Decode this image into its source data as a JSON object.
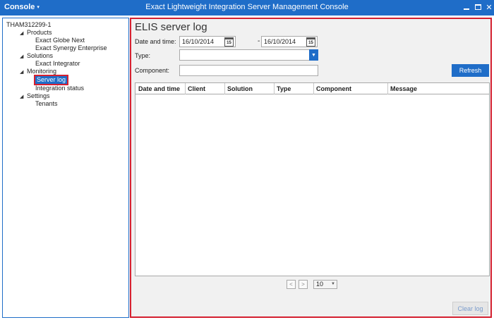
{
  "titlebar": {
    "menu_label": "Console",
    "menu_caret": "▾",
    "title": "Exact Lightweight Integration Server Management Console",
    "min_icon": "minimize-icon",
    "max_icon": "maximize-icon",
    "close_glyph": "✕"
  },
  "tree": {
    "root": "THAM312299-1",
    "products": "Products",
    "globe": "Exact Globe Next",
    "synergy": "Exact Synergy Enterprise",
    "solutions": "Solutions",
    "integrator": "Exact Integrator",
    "monitoring": "Monitoring",
    "server_log": "Server log",
    "integration_status": "Integration status",
    "settings": "Settings",
    "tenants": "Tenants",
    "expand_glyph": "◢"
  },
  "main": {
    "title": "ELIS server log",
    "date_label": "Date and time:",
    "date_from": "16/10/2014",
    "date_to": "16/10/2014",
    "date_sep": "-",
    "calendar_day": "15",
    "type_label": "Type:",
    "type_value": "",
    "component_label": "Component:",
    "component_value": "",
    "refresh_label": "Refresh",
    "columns": [
      "Date and time",
      "Client",
      "Solution",
      "Type",
      "Component",
      "Message"
    ],
    "pager": {
      "prev": "<",
      "next": ">",
      "page_size": "10"
    },
    "clear_log_label": "Clear log"
  },
  "colors": {
    "accent": "#1f6dc8",
    "highlight": "#d42030"
  }
}
